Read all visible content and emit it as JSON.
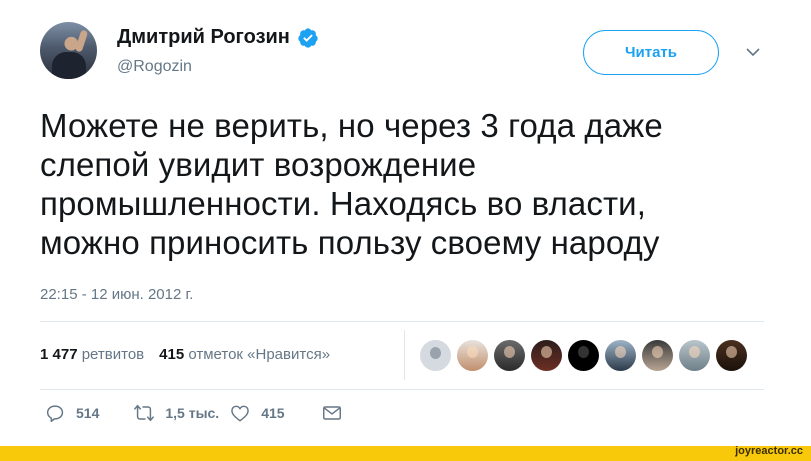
{
  "author": {
    "name": "Дмитрий Рогозин",
    "handle": "@Rogozin",
    "verified": true
  },
  "follow_button": {
    "label": "Читать"
  },
  "tweet": {
    "lines": [
      "Можете не верить, но через 3 года даже",
      "слепой увидит возрождение",
      "промышленности. Находясь во власти,",
      "можно приносить пользу своему народу"
    ],
    "timestamp": "22:15 - 12 июн. 2012 г."
  },
  "stats": {
    "retweets_count": "1 477",
    "retweets_label": "ретвитов",
    "likes_count": "415",
    "likes_label": "отметок «Нравится»"
  },
  "liker_avatars": [
    "default-avatar",
    "avatar-2",
    "avatar-3",
    "avatar-4",
    "avatar-5",
    "avatar-6",
    "avatar-7",
    "avatar-8",
    "avatar-9"
  ],
  "actions": {
    "replies": "514",
    "retweets": "1,5 тыс.",
    "likes": "415"
  },
  "watermark": "joyreactor.cc",
  "colors": {
    "accent": "#1da1f2",
    "verified": "#1da1f2",
    "muted": "#657786",
    "footer": "#f8c80a"
  }
}
